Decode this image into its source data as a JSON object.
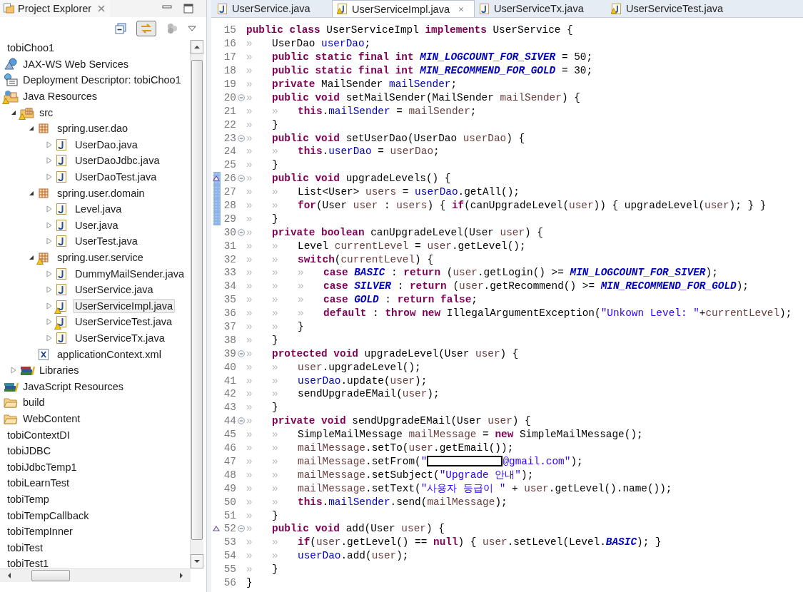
{
  "explorer": {
    "title": "Project Explorer",
    "tree": [
      {
        "label": "tobiChoo1",
        "kind": "project",
        "selected": false,
        "children": [
          {
            "label": "JAX-WS Web Services",
            "kind": "webservice",
            "selected": false
          },
          {
            "label": "Deployment Descriptor: tobiChoo1",
            "kind": "descriptor",
            "selected": false
          },
          {
            "label": "Java Resources",
            "kind": "javares",
            "warning": true,
            "selected": false,
            "children": [
              {
                "label": "src",
                "kind": "srcfolder",
                "warning": true,
                "expanded": true,
                "selected": false,
                "children": [
                  {
                    "label": "spring.user.dao",
                    "kind": "package",
                    "expanded": true,
                    "selected": false,
                    "children": [
                      {
                        "label": "UserDao.java",
                        "kind": "java",
                        "expanded": false,
                        "selected": false
                      },
                      {
                        "label": "UserDaoJdbc.java",
                        "kind": "java",
                        "expanded": false,
                        "selected": false
                      },
                      {
                        "label": "UserDaoTest.java",
                        "kind": "java",
                        "expanded": false,
                        "selected": false
                      }
                    ]
                  },
                  {
                    "label": "spring.user.domain",
                    "kind": "package",
                    "expanded": true,
                    "selected": false,
                    "children": [
                      {
                        "label": "Level.java",
                        "kind": "java",
                        "expanded": false,
                        "selected": false
                      },
                      {
                        "label": "User.java",
                        "kind": "java",
                        "expanded": false,
                        "selected": false
                      },
                      {
                        "label": "UserTest.java",
                        "kind": "java",
                        "expanded": false,
                        "selected": false
                      }
                    ]
                  },
                  {
                    "label": "spring.user.service",
                    "kind": "package",
                    "warning": true,
                    "expanded": true,
                    "selected": false,
                    "children": [
                      {
                        "label": "DummyMailSender.java",
                        "kind": "java",
                        "expanded": false,
                        "selected": false
                      },
                      {
                        "label": "UserService.java",
                        "kind": "java",
                        "expanded": false,
                        "selected": false
                      },
                      {
                        "label": "UserServiceImpl.java",
                        "kind": "java",
                        "warning": true,
                        "expanded": false,
                        "selected": true
                      },
                      {
                        "label": "UserServiceTest.java",
                        "kind": "java",
                        "warning": true,
                        "expanded": false,
                        "selected": false
                      },
                      {
                        "label": "UserServiceTx.java",
                        "kind": "java",
                        "expanded": false,
                        "selected": false
                      }
                    ]
                  },
                  {
                    "label": "applicationContext.xml",
                    "kind": "xml",
                    "selected": false
                  }
                ]
              },
              {
                "label": "Libraries",
                "kind": "library",
                "expanded": false,
                "selected": false
              }
            ]
          },
          {
            "label": "JavaScript Resources",
            "kind": "jslibrary",
            "selected": false
          },
          {
            "label": "build",
            "kind": "folder",
            "selected": false
          },
          {
            "label": "WebContent",
            "kind": "folder",
            "selected": false
          }
        ]
      },
      {
        "label": "tobiContextDI",
        "kind": "project",
        "selected": false
      },
      {
        "label": "tobiJDBC",
        "kind": "project",
        "selected": false
      },
      {
        "label": "tobiJdbcTemp1",
        "kind": "project",
        "selected": false
      },
      {
        "label": "tobiLearnTest",
        "kind": "project",
        "selected": false
      },
      {
        "label": "tobiTemp",
        "kind": "project",
        "selected": false
      },
      {
        "label": "tobiTempCallback",
        "kind": "project",
        "selected": false
      },
      {
        "label": "tobiTempInner",
        "kind": "project",
        "selected": false
      },
      {
        "label": "tobiTest",
        "kind": "project",
        "selected": false
      },
      {
        "label": "tobiTest1",
        "kind": "project",
        "selected": false
      }
    ]
  },
  "editor": {
    "tabs": [
      {
        "label": "UserService.java",
        "warning": false,
        "selected": false
      },
      {
        "label": "UserServiceImpl.java",
        "warning": true,
        "selected": true
      },
      {
        "label": "UserServiceTx.java",
        "warning": false,
        "selected": false
      },
      {
        "label": "UserServiceTest.java",
        "warning": true,
        "selected": false
      }
    ],
    "lines": [
      {
        "n": "15",
        "tokens": [
          {
            "kind": "keyword",
            "text": "public class"
          },
          {
            "kind": "plain",
            "text": " UserServiceImpl "
          },
          {
            "kind": "keyword",
            "text": "implements"
          },
          {
            "kind": "plain",
            "text": " UserService {"
          }
        ]
      },
      {
        "n": "16",
        "tokens": [
          {
            "kind": "tab",
            "text": "»"
          },
          {
            "kind": "plain",
            "text": "UserDao "
          },
          {
            "kind": "field",
            "text": "userDao"
          },
          {
            "kind": "plain",
            "text": ";"
          }
        ]
      },
      {
        "n": "17",
        "tokens": [
          {
            "kind": "tab",
            "text": "»"
          },
          {
            "kind": "keyword",
            "text": "public static final int "
          },
          {
            "kind": "constant",
            "text": "MIN_LOGCOUNT_FOR_SIVER"
          },
          {
            "kind": "plain",
            "text": " = 50;"
          }
        ]
      },
      {
        "n": "18",
        "tokens": [
          {
            "kind": "tab",
            "text": "»"
          },
          {
            "kind": "keyword",
            "text": "public static final int "
          },
          {
            "kind": "constant",
            "text": "MIN_RECOMMEND_FOR_GOLD"
          },
          {
            "kind": "plain",
            "text": " = 30;"
          }
        ]
      },
      {
        "n": "19",
        "tokens": [
          {
            "kind": "tab",
            "text": "»"
          },
          {
            "kind": "keyword",
            "text": "private"
          },
          {
            "kind": "plain",
            "text": " MailSender "
          },
          {
            "kind": "field",
            "text": "mailSender"
          },
          {
            "kind": "plain",
            "text": ";"
          }
        ]
      },
      {
        "n": "20",
        "fold": true,
        "tokens": [
          {
            "kind": "tab",
            "text": "»"
          },
          {
            "kind": "keyword",
            "text": "public void"
          },
          {
            "kind": "plain",
            "text": " setMailSender(MailSender "
          },
          {
            "kind": "variable",
            "text": "mailSender"
          },
          {
            "kind": "plain",
            "text": ") {"
          }
        ]
      },
      {
        "n": "21",
        "tokens": [
          {
            "kind": "tab",
            "text": "»"
          },
          {
            "kind": "tab",
            "text": "»"
          },
          {
            "kind": "keyword",
            "text": "this"
          },
          {
            "kind": "plain",
            "text": "."
          },
          {
            "kind": "field",
            "text": "mailSender"
          },
          {
            "kind": "plain",
            "text": " = "
          },
          {
            "kind": "variable",
            "text": "mailSender"
          },
          {
            "kind": "plain",
            "text": ";"
          }
        ]
      },
      {
        "n": "22",
        "tokens": [
          {
            "kind": "tab",
            "text": "»"
          },
          {
            "kind": "plain",
            "text": "}"
          }
        ]
      },
      {
        "n": "23",
        "fold": true,
        "tokens": [
          {
            "kind": "tab",
            "text": "»"
          },
          {
            "kind": "keyword",
            "text": "public void"
          },
          {
            "kind": "plain",
            "text": " setUserDao(UserDao "
          },
          {
            "kind": "variable",
            "text": "userDao"
          },
          {
            "kind": "plain",
            "text": ") {"
          }
        ]
      },
      {
        "n": "24",
        "tokens": [
          {
            "kind": "tab",
            "text": "»"
          },
          {
            "kind": "tab",
            "text": "»"
          },
          {
            "kind": "keyword",
            "text": "this"
          },
          {
            "kind": "plain",
            "text": "."
          },
          {
            "kind": "field",
            "text": "userDao"
          },
          {
            "kind": "plain",
            "text": " = "
          },
          {
            "kind": "variable",
            "text": "userDao"
          },
          {
            "kind": "plain",
            "text": ";"
          }
        ]
      },
      {
        "n": "25",
        "tokens": [
          {
            "kind": "tab",
            "text": "»"
          },
          {
            "kind": "plain",
            "text": "}"
          }
        ]
      },
      {
        "n": "26",
        "fold": true,
        "override": true,
        "changed": true,
        "tokens": [
          {
            "kind": "tab",
            "text": "»"
          },
          {
            "kind": "keyword",
            "text": "public void"
          },
          {
            "kind": "plain",
            "text": " upgradeLevels() {"
          }
        ]
      },
      {
        "n": "27",
        "changed": true,
        "tokens": [
          {
            "kind": "tab",
            "text": "»"
          },
          {
            "kind": "tab",
            "text": "»"
          },
          {
            "kind": "plain",
            "text": "List<User> "
          },
          {
            "kind": "variable",
            "text": "users"
          },
          {
            "kind": "plain",
            "text": " = "
          },
          {
            "kind": "field",
            "text": "userDao"
          },
          {
            "kind": "plain",
            "text": ".getAll();"
          }
        ]
      },
      {
        "n": "28",
        "changed": true,
        "tokens": [
          {
            "kind": "tab",
            "text": "»"
          },
          {
            "kind": "tab",
            "text": "»"
          },
          {
            "kind": "keyword",
            "text": "for"
          },
          {
            "kind": "plain",
            "text": "(User "
          },
          {
            "kind": "variable",
            "text": "user"
          },
          {
            "kind": "plain",
            "text": " : "
          },
          {
            "kind": "variable",
            "text": "users"
          },
          {
            "kind": "plain",
            "text": ") { "
          },
          {
            "kind": "keyword",
            "text": "if"
          },
          {
            "kind": "plain",
            "text": "(canUpgradeLevel("
          },
          {
            "kind": "variable",
            "text": "user"
          },
          {
            "kind": "plain",
            "text": ")) { upgradeLevel("
          },
          {
            "kind": "variable",
            "text": "user"
          },
          {
            "kind": "plain",
            "text": "); } }"
          }
        ]
      },
      {
        "n": "29",
        "changed": true,
        "tokens": [
          {
            "kind": "tab",
            "text": "»"
          },
          {
            "kind": "plain",
            "text": "}"
          }
        ]
      },
      {
        "n": "30",
        "fold": true,
        "tokens": [
          {
            "kind": "tab",
            "text": "»"
          },
          {
            "kind": "keyword",
            "text": "private boolean"
          },
          {
            "kind": "plain",
            "text": " canUpgradeLevel(User "
          },
          {
            "kind": "variable",
            "text": "user"
          },
          {
            "kind": "plain",
            "text": ") {"
          }
        ]
      },
      {
        "n": "31",
        "tokens": [
          {
            "kind": "tab",
            "text": "»"
          },
          {
            "kind": "tab",
            "text": "»"
          },
          {
            "kind": "plain",
            "text": "Level "
          },
          {
            "kind": "variable",
            "text": "currentLevel"
          },
          {
            "kind": "plain",
            "text": " = "
          },
          {
            "kind": "variable",
            "text": "user"
          },
          {
            "kind": "plain",
            "text": ".getLevel();"
          }
        ]
      },
      {
        "n": "32",
        "tokens": [
          {
            "kind": "tab",
            "text": "»"
          },
          {
            "kind": "tab",
            "text": "»"
          },
          {
            "kind": "keyword",
            "text": "switch"
          },
          {
            "kind": "plain",
            "text": "("
          },
          {
            "kind": "variable",
            "text": "currentLevel"
          },
          {
            "kind": "plain",
            "text": ") {"
          }
        ]
      },
      {
        "n": "33",
        "tokens": [
          {
            "kind": "tab",
            "text": "»"
          },
          {
            "kind": "tab",
            "text": "»"
          },
          {
            "kind": "tab",
            "text": "»"
          },
          {
            "kind": "keyword",
            "text": "case "
          },
          {
            "kind": "constant",
            "text": "BASIC"
          },
          {
            "kind": "plain",
            "text": " : "
          },
          {
            "kind": "keyword",
            "text": "return"
          },
          {
            "kind": "plain",
            "text": " ("
          },
          {
            "kind": "variable",
            "text": "user"
          },
          {
            "kind": "plain",
            "text": ".getLogin() >= "
          },
          {
            "kind": "constant",
            "text": "MIN_LOGCOUNT_FOR_SIVER"
          },
          {
            "kind": "plain",
            "text": ");"
          }
        ]
      },
      {
        "n": "34",
        "tokens": [
          {
            "kind": "tab",
            "text": "»"
          },
          {
            "kind": "tab",
            "text": "»"
          },
          {
            "kind": "tab",
            "text": "»"
          },
          {
            "kind": "keyword",
            "text": "case "
          },
          {
            "kind": "constant",
            "text": "SILVER"
          },
          {
            "kind": "plain",
            "text": " : "
          },
          {
            "kind": "keyword",
            "text": "return"
          },
          {
            "kind": "plain",
            "text": " ("
          },
          {
            "kind": "variable",
            "text": "user"
          },
          {
            "kind": "plain",
            "text": ".getRecommend() >= "
          },
          {
            "kind": "constant",
            "text": "MIN_RECOMMEND_FOR_GOLD"
          },
          {
            "kind": "plain",
            "text": ");"
          }
        ]
      },
      {
        "n": "35",
        "tokens": [
          {
            "kind": "tab",
            "text": "»"
          },
          {
            "kind": "tab",
            "text": "»"
          },
          {
            "kind": "tab",
            "text": "»"
          },
          {
            "kind": "keyword",
            "text": "case "
          },
          {
            "kind": "constant",
            "text": "GOLD"
          },
          {
            "kind": "plain",
            "text": " : "
          },
          {
            "kind": "keyword",
            "text": "return false"
          },
          {
            "kind": "plain",
            "text": ";"
          }
        ]
      },
      {
        "n": "36",
        "tokens": [
          {
            "kind": "tab",
            "text": "»"
          },
          {
            "kind": "tab",
            "text": "»"
          },
          {
            "kind": "tab",
            "text": "»"
          },
          {
            "kind": "keyword",
            "text": "default"
          },
          {
            "kind": "plain",
            "text": " : "
          },
          {
            "kind": "keyword",
            "text": "throw new"
          },
          {
            "kind": "plain",
            "text": " IllegalArgumentException("
          },
          {
            "kind": "string",
            "text": "\"Unkown Level: \""
          },
          {
            "kind": "plain",
            "text": "+"
          },
          {
            "kind": "variable",
            "text": "currentLevel"
          },
          {
            "kind": "plain",
            "text": ");"
          }
        ]
      },
      {
        "n": "37",
        "tokens": [
          {
            "kind": "tab",
            "text": "»"
          },
          {
            "kind": "tab",
            "text": "»"
          },
          {
            "kind": "plain",
            "text": "}"
          }
        ]
      },
      {
        "n": "38",
        "tokens": [
          {
            "kind": "tab",
            "text": "»"
          },
          {
            "kind": "plain",
            "text": "}"
          }
        ]
      },
      {
        "n": "39",
        "fold": true,
        "tokens": [
          {
            "kind": "tab",
            "text": "»"
          },
          {
            "kind": "keyword",
            "text": "protected void"
          },
          {
            "kind": "plain",
            "text": " upgradeLevel(User "
          },
          {
            "kind": "variable",
            "text": "user"
          },
          {
            "kind": "plain",
            "text": ") {"
          }
        ]
      },
      {
        "n": "40",
        "tokens": [
          {
            "kind": "tab",
            "text": "»"
          },
          {
            "kind": "tab",
            "text": "»"
          },
          {
            "kind": "variable",
            "text": "user"
          },
          {
            "kind": "plain",
            "text": ".upgradeLevel();"
          }
        ]
      },
      {
        "n": "41",
        "tokens": [
          {
            "kind": "tab",
            "text": "»"
          },
          {
            "kind": "tab",
            "text": "»"
          },
          {
            "kind": "field",
            "text": "userDao"
          },
          {
            "kind": "plain",
            "text": ".update("
          },
          {
            "kind": "variable",
            "text": "user"
          },
          {
            "kind": "plain",
            "text": ");"
          }
        ]
      },
      {
        "n": "42",
        "tokens": [
          {
            "kind": "tab",
            "text": "»"
          },
          {
            "kind": "tab",
            "text": "»"
          },
          {
            "kind": "plain",
            "text": "sendUpgradeEMail("
          },
          {
            "kind": "variable",
            "text": "user"
          },
          {
            "kind": "plain",
            "text": ");"
          }
        ]
      },
      {
        "n": "43",
        "tokens": [
          {
            "kind": "tab",
            "text": "»"
          },
          {
            "kind": "plain",
            "text": "}"
          }
        ]
      },
      {
        "n": "44",
        "fold": true,
        "tokens": [
          {
            "kind": "tab",
            "text": "»"
          },
          {
            "kind": "keyword",
            "text": "private void"
          },
          {
            "kind": "plain",
            "text": " sendUpgradeEMail(User "
          },
          {
            "kind": "variable",
            "text": "user"
          },
          {
            "kind": "plain",
            "text": ") {"
          }
        ]
      },
      {
        "n": "45",
        "tokens": [
          {
            "kind": "tab",
            "text": "»"
          },
          {
            "kind": "tab",
            "text": "»"
          },
          {
            "kind": "plain",
            "text": "SimpleMailMessage "
          },
          {
            "kind": "variable",
            "text": "mailMessage"
          },
          {
            "kind": "plain",
            "text": " = "
          },
          {
            "kind": "keyword",
            "text": "new"
          },
          {
            "kind": "plain",
            "text": " SimpleMailMessage();"
          }
        ]
      },
      {
        "n": "46",
        "tokens": [
          {
            "kind": "tab",
            "text": "»"
          },
          {
            "kind": "tab",
            "text": "»"
          },
          {
            "kind": "variable",
            "text": "mailMessage"
          },
          {
            "kind": "plain",
            "text": ".setTo("
          },
          {
            "kind": "variable",
            "text": "user"
          },
          {
            "kind": "plain",
            "text": ".getEmail());"
          }
        ]
      },
      {
        "n": "47",
        "tokens": [
          {
            "kind": "tab",
            "text": "»"
          },
          {
            "kind": "tab",
            "text": "»"
          },
          {
            "kind": "variable",
            "text": "mailMessage"
          },
          {
            "kind": "plain",
            "text": ".setFrom("
          },
          {
            "kind": "string",
            "text": "\""
          },
          {
            "kind": "redaction"
          },
          {
            "kind": "string",
            "text": "@gmail.com\""
          },
          {
            "kind": "plain",
            "text": ");"
          }
        ]
      },
      {
        "n": "48",
        "tokens": [
          {
            "kind": "tab",
            "text": "»"
          },
          {
            "kind": "tab",
            "text": "»"
          },
          {
            "kind": "variable",
            "text": "mailMessage"
          },
          {
            "kind": "plain",
            "text": ".setSubject("
          },
          {
            "kind": "string",
            "text": "\"Upgrade 안내\""
          },
          {
            "kind": "plain",
            "text": ");"
          }
        ]
      },
      {
        "n": "49",
        "tokens": [
          {
            "kind": "tab",
            "text": "»"
          },
          {
            "kind": "tab",
            "text": "»"
          },
          {
            "kind": "variable",
            "text": "mailMessage"
          },
          {
            "kind": "plain",
            "text": ".setText("
          },
          {
            "kind": "string",
            "text": "\"사용자 등급이 \""
          },
          {
            "kind": "plain",
            "text": " + "
          },
          {
            "kind": "variable",
            "text": "user"
          },
          {
            "kind": "plain",
            "text": ".getLevel().name());"
          }
        ]
      },
      {
        "n": "50",
        "tokens": [
          {
            "kind": "tab",
            "text": "»"
          },
          {
            "kind": "tab",
            "text": "»"
          },
          {
            "kind": "keyword",
            "text": "this"
          },
          {
            "kind": "plain",
            "text": "."
          },
          {
            "kind": "field",
            "text": "mailSender"
          },
          {
            "kind": "plain",
            "text": ".send("
          },
          {
            "kind": "variable",
            "text": "mailMessage"
          },
          {
            "kind": "plain",
            "text": ");"
          }
        ]
      },
      {
        "n": "51",
        "tokens": [
          {
            "kind": "tab",
            "text": "»"
          },
          {
            "kind": "plain",
            "text": "}"
          }
        ]
      },
      {
        "n": "52",
        "fold": true,
        "override": true,
        "tokens": [
          {
            "kind": "tab",
            "text": "»"
          },
          {
            "kind": "keyword",
            "text": "public void"
          },
          {
            "kind": "plain",
            "text": " add(User "
          },
          {
            "kind": "variable",
            "text": "user"
          },
          {
            "kind": "plain",
            "text": ") {"
          }
        ]
      },
      {
        "n": "53",
        "tokens": [
          {
            "kind": "tab",
            "text": "»"
          },
          {
            "kind": "tab",
            "text": "»"
          },
          {
            "kind": "keyword",
            "text": "if"
          },
          {
            "kind": "plain",
            "text": "("
          },
          {
            "kind": "variable",
            "text": "user"
          },
          {
            "kind": "plain",
            "text": ".getLevel() == "
          },
          {
            "kind": "keyword",
            "text": "null"
          },
          {
            "kind": "plain",
            "text": ") { "
          },
          {
            "kind": "variable",
            "text": "user"
          },
          {
            "kind": "plain",
            "text": ".setLevel(Level."
          },
          {
            "kind": "constant",
            "text": "BASIC"
          },
          {
            "kind": "plain",
            "text": "); }"
          }
        ]
      },
      {
        "n": "54",
        "tokens": [
          {
            "kind": "tab",
            "text": "»"
          },
          {
            "kind": "tab",
            "text": "»"
          },
          {
            "kind": "field",
            "text": "userDao"
          },
          {
            "kind": "plain",
            "text": ".add("
          },
          {
            "kind": "variable",
            "text": "user"
          },
          {
            "kind": "plain",
            "text": ");"
          }
        ]
      },
      {
        "n": "55",
        "tokens": [
          {
            "kind": "tab",
            "text": "»"
          },
          {
            "kind": "plain",
            "text": "}"
          }
        ]
      },
      {
        "n": "56",
        "tokens": [
          {
            "kind": "plain",
            "text": "}"
          }
        ]
      }
    ]
  }
}
